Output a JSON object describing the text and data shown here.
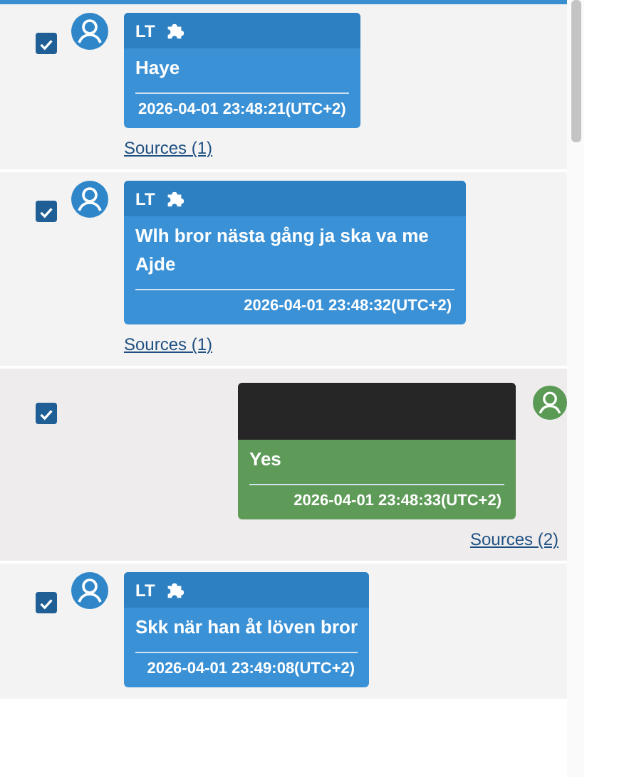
{
  "messages": [
    {
      "kind": "incoming",
      "checked": true,
      "sender": "LT",
      "redacted": false,
      "text": "Haye",
      "timestamp": "2026-04-01 23:48:21(UTC+2)",
      "sources": "Sources (1)"
    },
    {
      "kind": "incoming",
      "checked": true,
      "sender": "LT",
      "redacted": false,
      "text": "Wlh bror nästa gång ja ska va me Ajde",
      "timestamp": "2026-04-01 23:48:32(UTC+2)",
      "sources": "Sources (1)"
    },
    {
      "kind": "outgoing",
      "checked": true,
      "redacted": true,
      "text": "Yes",
      "timestamp": "2026-04-01 23:48:33(UTC+2)",
      "sources": "Sources (2)"
    },
    {
      "kind": "incoming",
      "checked": true,
      "sender": "LT",
      "redacted": false,
      "text": "Skk när han åt löven bror",
      "timestamp": "2026-04-01 23:49:08(UTC+2)"
    }
  ]
}
